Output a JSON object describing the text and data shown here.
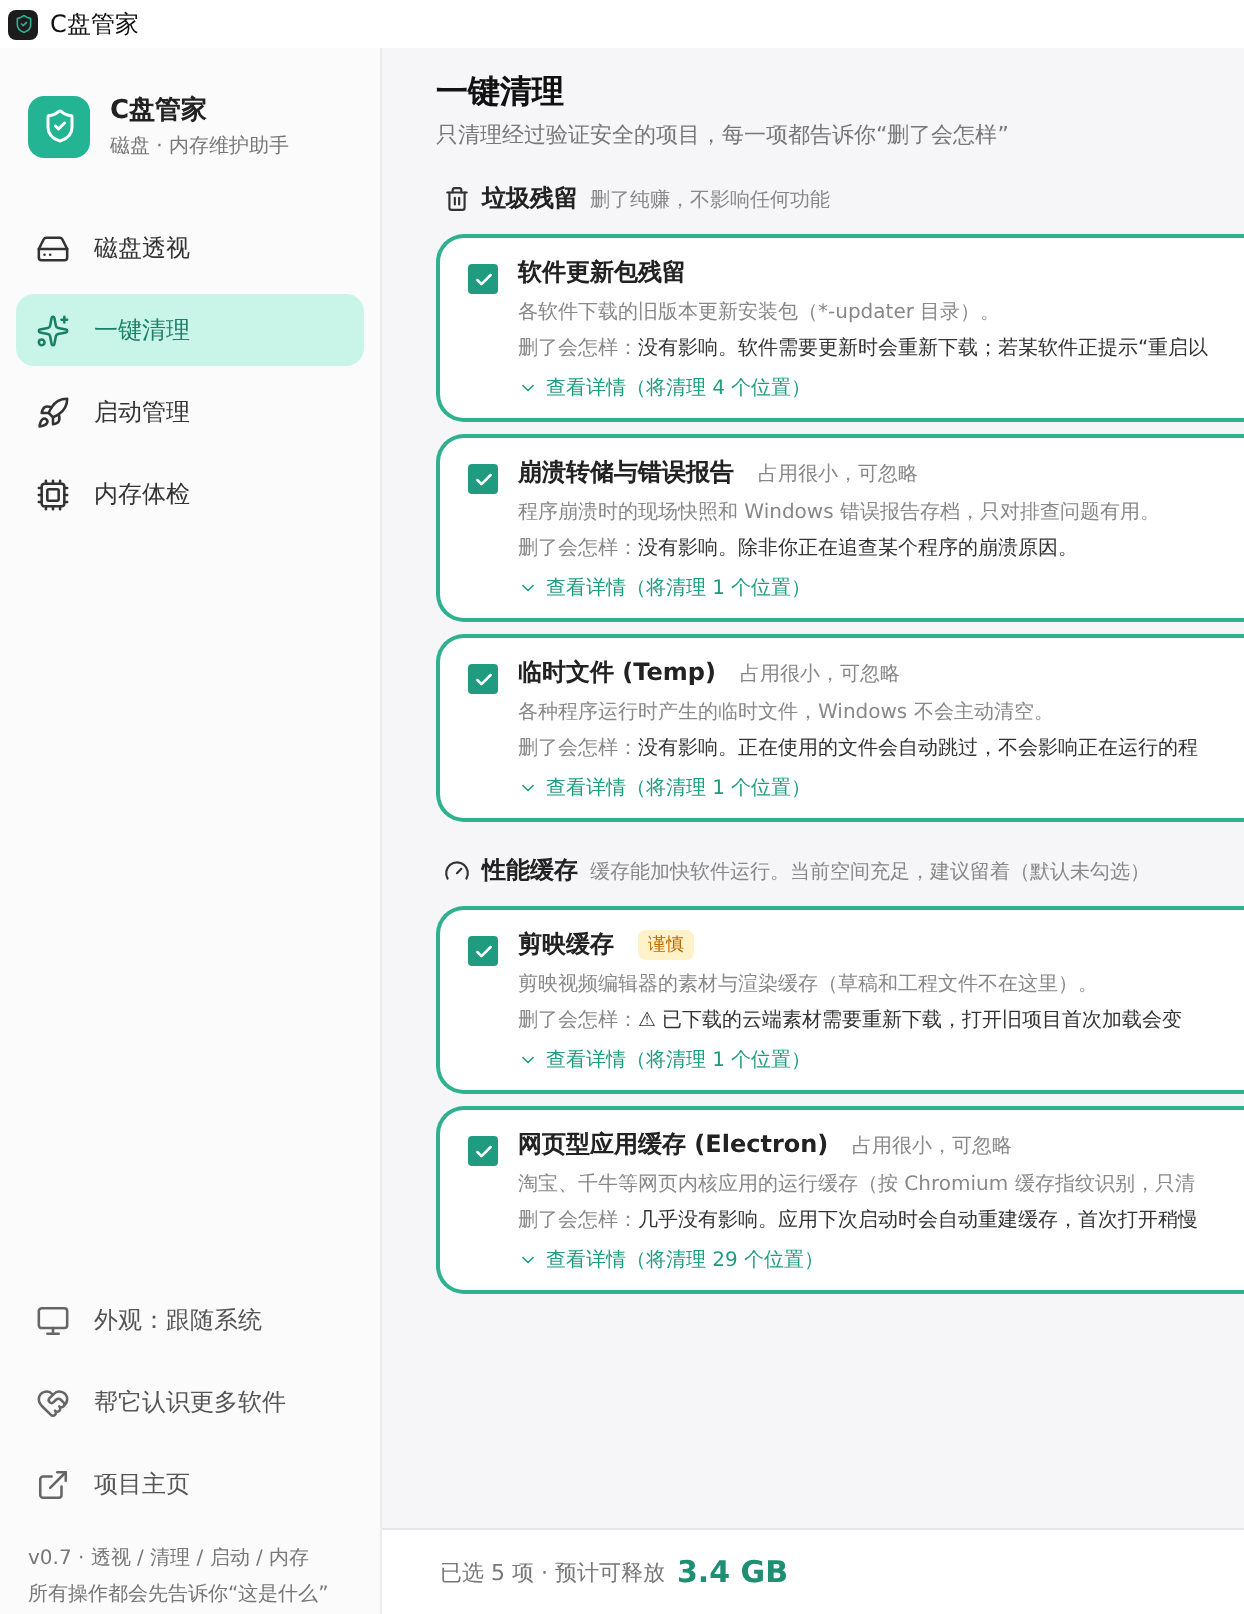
{
  "window": {
    "title": "C盘管家"
  },
  "brand": {
    "name": "C盘管家",
    "subtitle": "磁盘 · 内存维护助手"
  },
  "nav": [
    {
      "label": "磁盘透视",
      "selected": false
    },
    {
      "label": "一键清理",
      "selected": true
    },
    {
      "label": "启动管理",
      "selected": false
    },
    {
      "label": "内存体检",
      "selected": false
    }
  ],
  "sidebar_links": [
    {
      "label": "外观：跟随系统"
    },
    {
      "label": "帮它认识更多软件"
    },
    {
      "label": "项目主页"
    }
  ],
  "version_note": [
    "v0.7 · 透视 / 清理 / 启动 / 内存",
    "所有操作都会先告诉你“这是什么”"
  ],
  "page": {
    "title": "一键清理",
    "subtitle": "只清理经过验证安全的项目，每一项都告诉你“删了会怎样”"
  },
  "sections": [
    {
      "title": "垃圾残留",
      "note": "删了纯赚，不影响任何功能",
      "items": [
        {
          "name": "软件更新包残留",
          "checked": true,
          "desc": "各软件下载的旧版本更新安装包（*-updater 目录）。",
          "effect_label": "删了会怎样：",
          "effect": "没有影响。软件需要更新时会重新下载；若某软件正提示“重启以",
          "details": "查看详情（将清理 4 个位置）"
        },
        {
          "name": "崩溃转储与错误报告",
          "tag": "占用很小，可忽略",
          "checked": true,
          "desc": "程序崩溃时的现场快照和 Windows 错误报告存档，只对排查问题有用。",
          "effect_label": "删了会怎样：",
          "effect": "没有影响。除非你正在追查某个程序的崩溃原因。",
          "details": "查看详情（将清理 1 个位置）"
        },
        {
          "name": "临时文件 (Temp)",
          "tag": "占用很小，可忽略",
          "checked": true,
          "desc": "各种程序运行时产生的临时文件，Windows 不会主动清空。",
          "effect_label": "删了会怎样：",
          "effect": "没有影响。正在使用的文件会自动跳过，不会影响正在运行的程",
          "details": "查看详情（将清理 1 个位置）"
        }
      ]
    },
    {
      "title": "性能缓存",
      "note": "缓存能加快软件运行。当前空间充足，建议留着（默认未勾选）",
      "items": [
        {
          "name": "剪映缓存",
          "badge": "谨慎",
          "checked": true,
          "desc": "剪映视频编辑器的素材与渲染缓存（草稿和工程文件不在这里）。",
          "effect_label": "删了会怎样：",
          "effect": "⚠ 已下载的云端素材需要重新下载，打开旧项目首次加载会变",
          "details": "查看详情（将清理 1 个位置）"
        },
        {
          "name": "网页型应用缓存 (Electron)",
          "tag": "占用很小，可忽略",
          "checked": true,
          "desc": "淘宝、千牛等网页内核应用的运行缓存（按 Chromium 缓存指纹识别，只清",
          "effect_label": "删了会怎样：",
          "effect": "几乎没有影响。应用下次启动时会自动重建缓存，首次打开稍慢",
          "details": "查看详情（将清理 29 个位置）"
        }
      ]
    }
  ],
  "footer": {
    "summary": "已选 5 项 · 预计可释放",
    "size": "3.4 GB"
  }
}
